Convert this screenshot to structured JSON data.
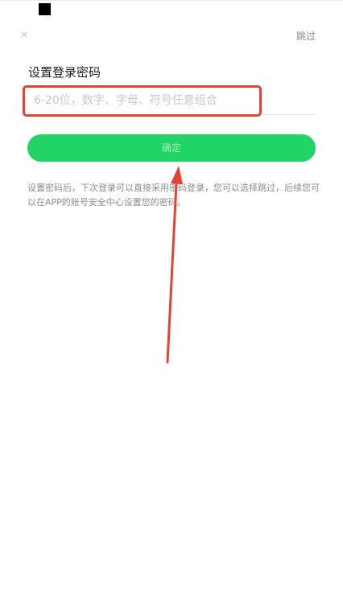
{
  "header": {
    "close_icon": "close-icon",
    "skip_label": "跳过"
  },
  "form": {
    "title": "设置登录密码",
    "password_placeholder": "6-20位，数字、字母、符号任意组合",
    "password_value": "",
    "confirm_label": "确定"
  },
  "hint": {
    "text": "设置密码后，下次登录可以直接采用密码登录，您可以选择跳过，后续您可以在APP的账号安全中心设置您的密码。"
  },
  "annotation": {
    "highlight_color": "#e34234",
    "arrow_color": "#e34234"
  },
  "colors": {
    "accent": "#21d466",
    "button_text": "#a8eec3",
    "text_primary": "#1c1c1c",
    "text_secondary": "#8c8c8c",
    "placeholder": "#c8c8c8"
  }
}
